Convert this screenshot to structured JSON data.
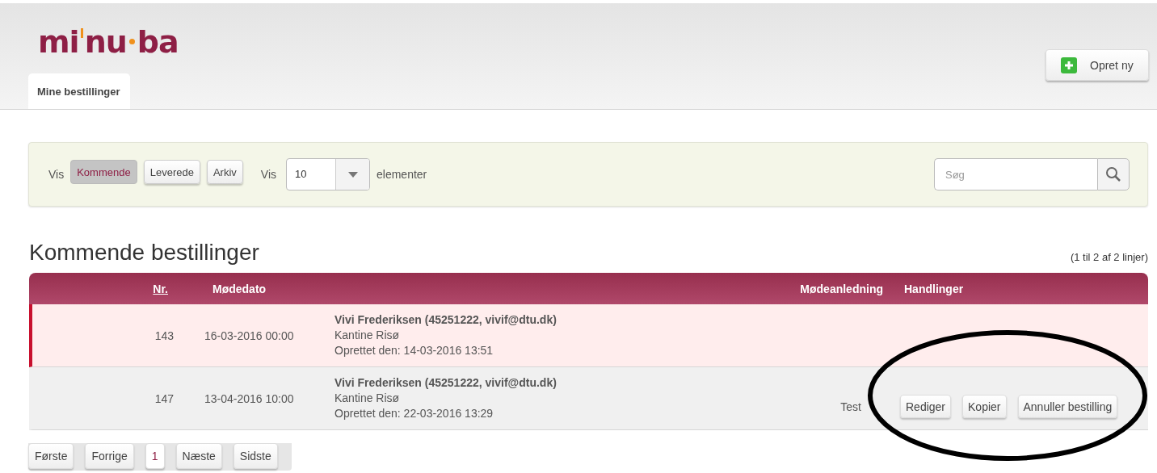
{
  "logo": {
    "parts": [
      "mi",
      "nu",
      "ba"
    ]
  },
  "create_button": {
    "label": "Opret ny"
  },
  "tabs": [
    {
      "label": "Mine bestillinger",
      "selected": true
    }
  ],
  "filter": {
    "label": "Vis",
    "toggles": [
      {
        "label": "Kommende",
        "selected": true
      },
      {
        "label": "Leverede",
        "selected": false
      },
      {
        "label": "Arkiv",
        "selected": false
      }
    ],
    "page_size": {
      "label": "Vis",
      "value": "10",
      "suffix": "elementer"
    },
    "search": {
      "placeholder": "Søg"
    }
  },
  "section_title": "Kommende bestillinger",
  "count": "(1 til 2 af 2 linjer)",
  "table": {
    "columns": [
      {
        "label": "Nr.",
        "sortable": true
      },
      {
        "label": "Mødedato",
        "sortable": false
      },
      {
        "label": "Mødeanledning",
        "sortable": false
      },
      {
        "label": "Handlinger",
        "sortable": false
      }
    ],
    "rows": [
      {
        "nr": "143",
        "date": "16-03-2016 00:00",
        "contact": "Vivi Frederiksen (45251222, vivif@dtu.dk)",
        "location": "Kantine Risø",
        "created": "Oprettet den:  14-03-2016 13:51",
        "highlighted": true,
        "occasion": "",
        "actions": []
      },
      {
        "nr": "147",
        "date": "13-04-2016 10:00",
        "contact": "Vivi Frederiksen (45251222, vivif@dtu.dk)",
        "location": "Kantine Risø",
        "created": "Oprettet den:  22-03-2016 13:29",
        "highlighted": false,
        "occasion": "Test",
        "actions": [
          "Rediger",
          "Kopier",
          "Annuller bestilling"
        ]
      }
    ]
  },
  "pagination": [
    {
      "label": "Første",
      "selected": false
    },
    {
      "label": "Forrige",
      "selected": false
    },
    {
      "label": "1",
      "selected": true
    },
    {
      "label": "Næste",
      "selected": false
    },
    {
      "label": "Sidste",
      "selected": false
    }
  ]
}
